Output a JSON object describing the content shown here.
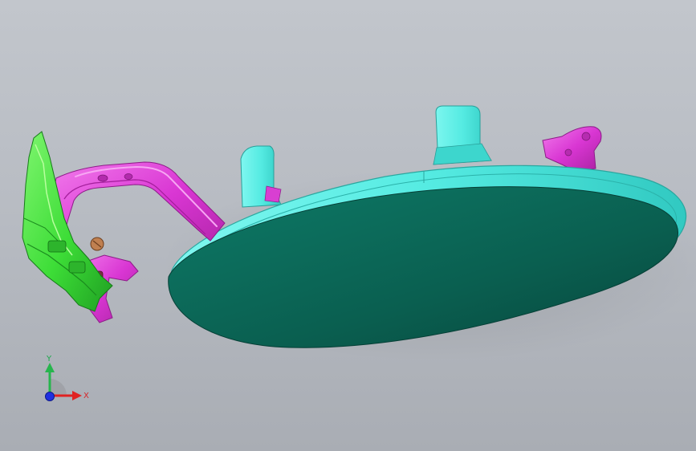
{
  "viewport": {
    "background_top": "#c2c6cc",
    "background_bottom": "#a9adb4"
  },
  "model": {
    "body_color": "#0b6656",
    "rim_color": "#49e8df",
    "hinge_color": "#e14bdc",
    "bracket_color": "#3ce23a",
    "pin_color": "#b27a4a"
  },
  "triad": {
    "x_label": "X",
    "y_label": "Y",
    "x_color": "#e02222",
    "y_color": "#27b54d",
    "z_color": "#2030e0"
  }
}
